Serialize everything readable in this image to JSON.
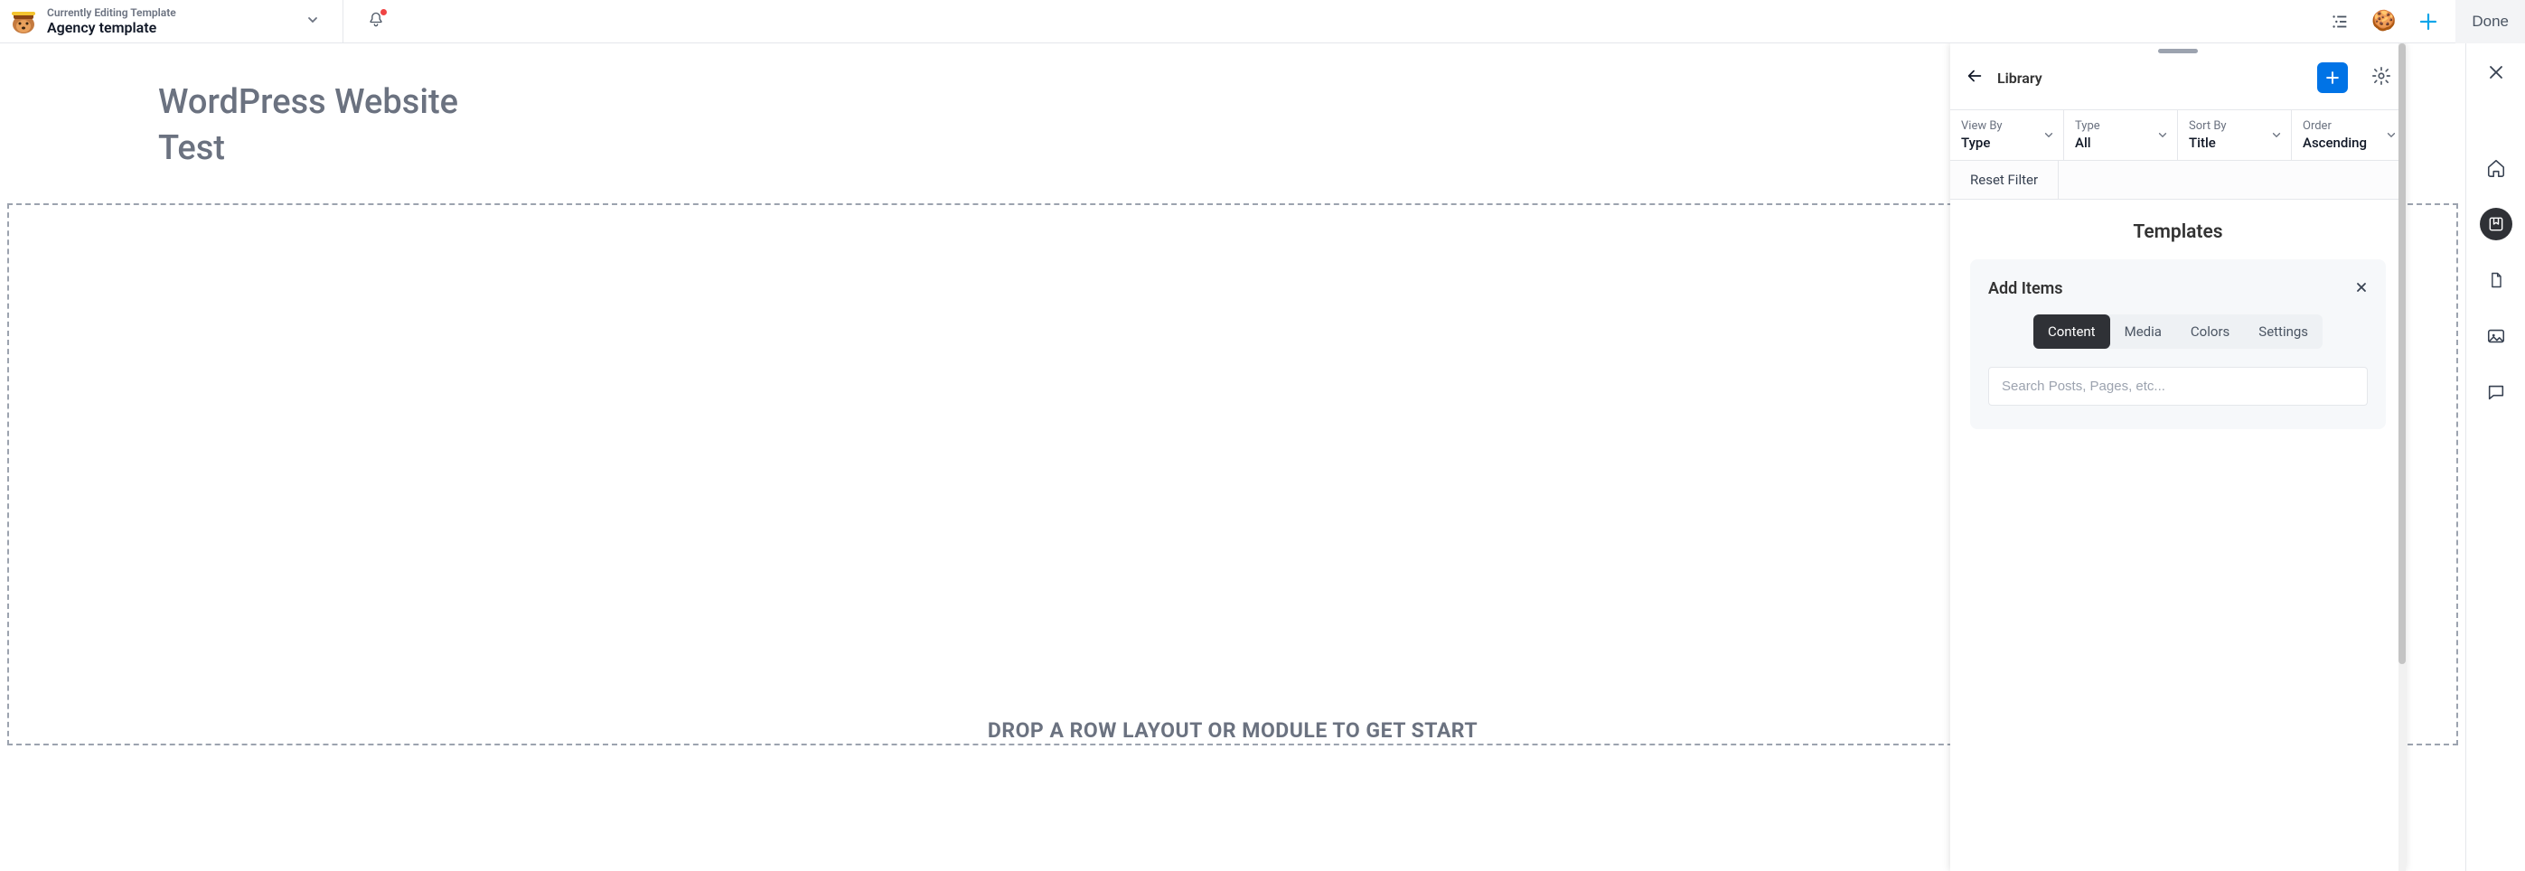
{
  "header": {
    "editing_label": "Currently Editing Template",
    "template_name": "Agency template",
    "done_label": "Done"
  },
  "site": {
    "heading_line1": "WordPress Website",
    "heading_line2": "Test",
    "dropzone_text": "DROP A ROW LAYOUT OR MODULE TO GET START"
  },
  "library": {
    "title": "Library",
    "filters": {
      "view_by": {
        "label": "View By",
        "value": "Type"
      },
      "type": {
        "label": "Type",
        "value": "All"
      },
      "sort_by": {
        "label": "Sort By",
        "value": "Title"
      },
      "order": {
        "label": "Order",
        "value": "Ascending"
      }
    },
    "reset_label": "Reset Filter",
    "section_title": "Templates",
    "add_items": {
      "title": "Add Items",
      "tabs": [
        "Content",
        "Media",
        "Colors",
        "Settings"
      ],
      "active_tab": "Content",
      "search_placeholder": "Search Posts, Pages, etc..."
    }
  }
}
